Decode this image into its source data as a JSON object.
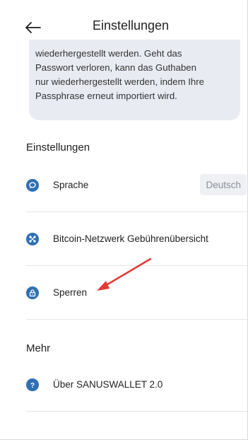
{
  "header": {
    "title": "Einstellungen",
    "back_icon": "arrow-left-icon"
  },
  "info": {
    "lines": [
      "wiederhergestellt werden. Geht das",
      "Passwort verloren, kann das Guthaben",
      "nur wiederhergestellt werden, indem Ihre",
      "Passphrase erneut importiert wird."
    ]
  },
  "sections": {
    "settings_title": "Einstellungen",
    "more_title": "Mehr"
  },
  "settings_items": [
    {
      "label": "Sprache",
      "icon": "chat-bubble-icon",
      "value": "Deutsch"
    },
    {
      "label": "Bitcoin-Netzwerk Gebührenübersicht",
      "icon": "network-icon"
    },
    {
      "label": "Sperren",
      "icon": "lock-icon"
    }
  ],
  "more_items": [
    {
      "label": "Über SANUSWALLET 2.0",
      "icon": "help-icon"
    }
  ],
  "colors": {
    "accent": "#2f6fb3",
    "annotation_arrow": "#e53935",
    "info_bg": "#e9ebf3"
  }
}
